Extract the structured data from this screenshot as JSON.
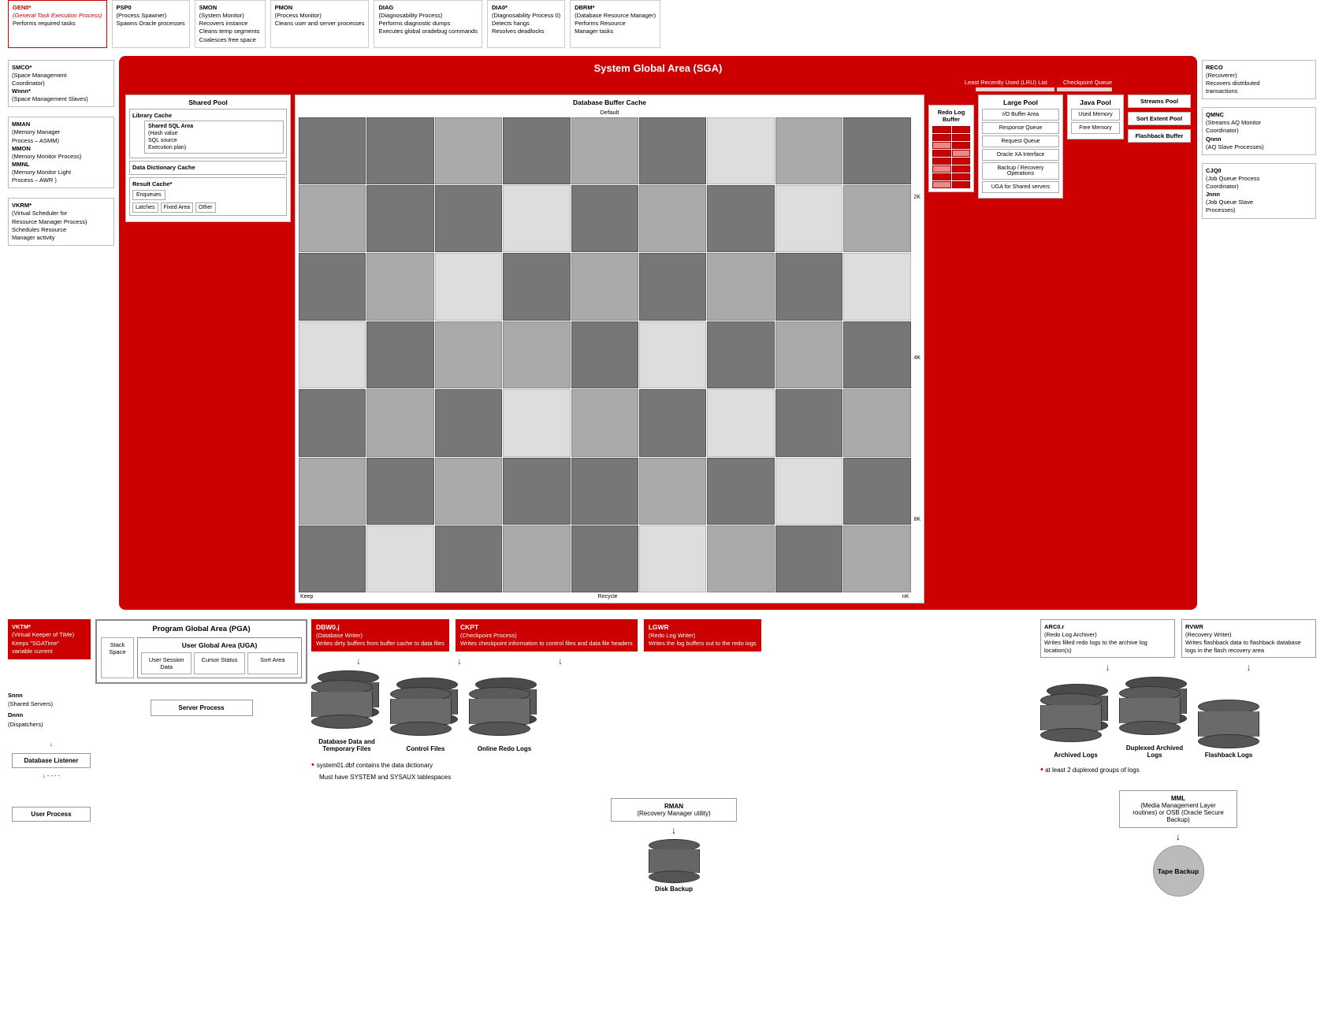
{
  "top_processes": [
    {
      "id": "gen0",
      "title": "GEN0*",
      "subtitle": "(General Task Execution Process)",
      "desc": "Performs required tasks",
      "red": true
    },
    {
      "id": "psp0",
      "title": "PSP0",
      "subtitle": "(Process Spawner)",
      "desc": "Spawns Oracle processes",
      "red": false
    },
    {
      "id": "smon",
      "title": "SMON",
      "subtitle": "(System Monitor)",
      "desc": "Recovers instance\nCleans temp segments\nCoalesces free space",
      "red": false
    },
    {
      "id": "pmon",
      "title": "PMON",
      "subtitle": "(Process Monitor)",
      "desc": "Cleans user and server processes",
      "red": false
    },
    {
      "id": "diag",
      "title": "DIAG",
      "subtitle": "(Diagnosability Process)",
      "desc": "Performs diagnostic dumps\nExecutes global oradebug commands",
      "red": false
    },
    {
      "id": "dia0",
      "title": "DIA0*",
      "subtitle": "(Diagnosability Process 0)",
      "desc": "Detects hangs\nResolves deadlocks",
      "red": false
    },
    {
      "id": "dbrm",
      "title": "DBRM*",
      "subtitle": "(Database Resource Manager)",
      "desc": "Performs Resource Manager tasks",
      "red": false
    }
  ],
  "left_annotations": [
    {
      "id": "smco",
      "lines": [
        "SMCO*",
        "(Space Management",
        "Coordinator)",
        "Wnnn*",
        "(Space Management Slaves)"
      ]
    },
    {
      "id": "mman",
      "lines": [
        "MMAN",
        "(Memory Manager",
        "Process – ASMM)",
        "MMON",
        "(Memory Monitor Process)",
        "MMNL",
        "(Memory Monitor Light",
        "Process – AWR )"
      ]
    },
    {
      "id": "vkrm",
      "lines": [
        "VKRM*",
        "(Virtual Scheduler for",
        "Resource Manager Process)",
        "Schedules Resource",
        "Manager activity"
      ]
    }
  ],
  "right_annotations": [
    {
      "id": "reco",
      "lines": [
        "RECO",
        "(Recoverer)",
        "Recovers distributed",
        "transactions"
      ]
    },
    {
      "id": "qmnc",
      "lines": [
        "QMNC",
        "(Streams AQ Monitor",
        "Coordinator)",
        "Qnnn",
        "(AQ Slave Processes)"
      ]
    },
    {
      "id": "cjq0",
      "lines": [
        "CJQ0",
        "(Job Queue Process",
        "Coordinator)",
        "Jnnn",
        "(Job Queue Slave",
        "Processes)"
      ]
    }
  ],
  "sga": {
    "title": "System Global Area (SGA)",
    "lru_label": "Least Recently Used (LRU) List",
    "checkpoint_label": "Checkpoint Queue",
    "shared_pool": {
      "title": "Shared Pool",
      "library_cache": {
        "title": "Library Cache",
        "shared_sql": {
          "title": "Shared SQL Area",
          "items": [
            "Hash value",
            "SQL source",
            "Execution plan"
          ]
        }
      },
      "data_dict": {
        "title": "Data Dictionary Cache"
      },
      "result_cache": {
        "title": "Result Cache*",
        "enqueues": "Enqueues",
        "latches": "Latches",
        "fixed_area": "Fixed Area",
        "other": "Other"
      }
    },
    "dbc": {
      "title": "Database Buffer Cache",
      "default_label": "Default",
      "labels_bottom": [
        "Keep",
        "Recycle",
        "nK"
      ],
      "k_labels": [
        "2K",
        "4K",
        "8K"
      ]
    },
    "redo_log": {
      "title": "Redo Log Buffer"
    },
    "large_pool": {
      "title": "Large Pool",
      "items": [
        "I/O Buffer Area",
        "Response Queue",
        "Request Queue",
        "Oracle XA Interface",
        "Backup / Recovery Operations",
        "UGA for Shared servers"
      ]
    },
    "java_pool": {
      "title": "Java Pool",
      "items": [
        "Used Memory",
        "Free Memory"
      ]
    },
    "streams_pool": "Streams Pool",
    "sort_extent": "Sort Extent Pool",
    "flashback_buffer": "Flashback Buffer"
  },
  "bottom": {
    "vktm": {
      "title": "VKTM*",
      "subtitle": "(Virtual Keeper of TiMe)",
      "desc1": "Keeps \"SGATime\"",
      "desc2": "variable current"
    },
    "snnn": {
      "line1": "Snnn",
      "line2": "(Shared Servers)",
      "line3": "Dnnn",
      "line4": "(Dispatchers)"
    },
    "pga": {
      "title": "Program Global Area (PGA)",
      "uga": {
        "title": "User Global Area (UGA)",
        "cols": [
          "User Session Data",
          "Cursor Status",
          "Sort Area"
        ],
        "stack": "Stack Space"
      }
    },
    "server_process": "Server Process",
    "db_listener": "Database Listener",
    "user_process": "User Process",
    "bg_processes": [
      {
        "id": "dbw0",
        "title": "DBW0.j",
        "subtitle": "(Database Writer)",
        "desc": "Writes dirty buffers from buffer cache to data files"
      },
      {
        "id": "ckpt",
        "title": "CKPT",
        "subtitle": "(Checkpoint Process)",
        "desc": "Writes checkpoint information to control files and data file headers"
      },
      {
        "id": "lgwr",
        "title": "LGWR",
        "subtitle": "(Redo Log Writer)",
        "desc": "Writes the log buffers out to the redo logs"
      }
    ],
    "arc": {
      "title": "ARC0.r",
      "subtitle": "(Redo Log Archiver)",
      "desc": "Writes filled redo logs to the archive log location(s)"
    },
    "rvwr": {
      "title": "RVWR",
      "subtitle": "(Recovery Writer)",
      "desc": "Writes flashback data to flashback database logs in the flash recovery area"
    },
    "databases": [
      {
        "id": "db_data",
        "label": "Database Data and Temporary Files",
        "stacked": true
      },
      {
        "id": "control",
        "label": "Control Files",
        "stacked": true
      },
      {
        "id": "online_redo",
        "label": "Online Redo Logs",
        "stacked": true
      },
      {
        "id": "archived",
        "label": "Archived Logs",
        "stacked": true
      },
      {
        "id": "duplexed",
        "label": "Duplexed Archived Logs",
        "stacked": true
      },
      {
        "id": "flashback",
        "label": "Flashback Logs",
        "stacked": false
      }
    ],
    "notes": [
      "system01.dbf contains the data dictionary\nMust have SYSTEM and SYSAUX tablespaces",
      "at least 2 duplexed groups of logs"
    ],
    "rman": {
      "title": "RMAN",
      "subtitle": "(Recovery Manager utility)"
    },
    "mml": {
      "title": "MML",
      "subtitle": "(Media Management Layer routines) or OSB (Oracle Secure Backup)"
    },
    "disk_backup": "Disk Backup",
    "tape_backup": "Tape Backup"
  }
}
